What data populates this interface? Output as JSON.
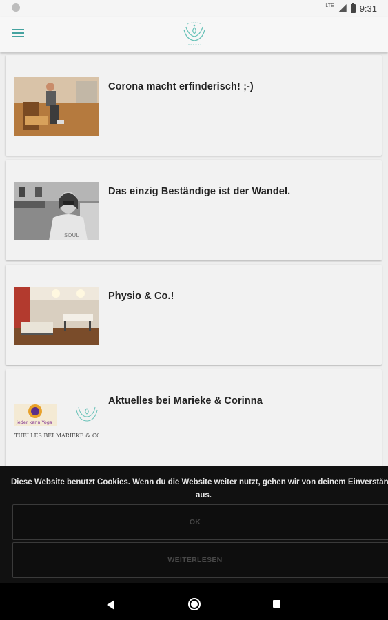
{
  "status_bar": {
    "network": "LTE",
    "time": "9:31"
  },
  "app_bar": {
    "menu_icon": "hamburger-menu-icon",
    "logo_icon": "yoga-logo-icon"
  },
  "posts": [
    {
      "title": "Corona macht erfinderisch! ;-)",
      "image": "woman-with-step-board-photo"
    },
    {
      "title": "Das einzig Beständige ist der Wandel.",
      "image": "woman-portrait-bw-photo"
    },
    {
      "title": "Physio & Co.!",
      "image": "physio-room-photo"
    },
    {
      "title": "Aktuelles bei Marieke & Corinna",
      "image": "yoga-logos-banner",
      "banner_text": "jeder kann Yoga",
      "banner_caption": "TUELLES BEI MARIEKE & CORIN"
    }
  ],
  "cookie_banner": {
    "text_line1": "Diese Website benutzt Cookies. Wenn du die Website weiter nutzt, gehen wir von deinem Einverständn",
    "text_line2": "aus.",
    "ok_label": "OK",
    "more_label": "WEITERLESEN"
  },
  "nav_bar": {
    "back": "back-icon",
    "home": "home-icon",
    "recents": "recents-icon"
  }
}
